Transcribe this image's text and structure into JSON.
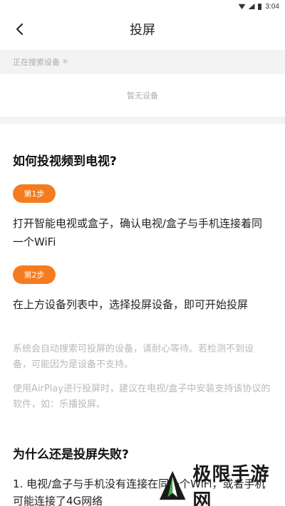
{
  "status_bar": {
    "time": "3:04"
  },
  "header": {
    "title": "投屏"
  },
  "search": {
    "status_text": "正在搜索设备"
  },
  "device_list": {
    "empty_text": "暂无设备"
  },
  "guide": {
    "title": "如何投视频到电视?",
    "steps": [
      {
        "badge": "第1步",
        "text": "打开智能电视或盒子，确认电视/盒子与手机连接着同一个WiFi"
      },
      {
        "badge": "第2步",
        "text": "在上方设备列表中，选择投屏设备，即可开始投屏"
      }
    ],
    "notes": [
      "系统会自动搜索可投屏的设备，请耐心等待。若检测不到设备，可能因为是设备不支持。",
      "使用AirPlay进行投屏时，建议在电视/盒子中安装支持该协议的软件，如：乐播投屏。"
    ]
  },
  "failure": {
    "title": "为什么还是投屏失败?",
    "reason_1": "1. 电视/盒子与手机没有连接在同一个WiFi，或者手机可能连接了4G网络"
  },
  "watermark": {
    "text": "极限手游网"
  },
  "colors": {
    "accent": "#f47c1f",
    "muted": "#b9b9b9",
    "band": "#f3f3f3"
  }
}
